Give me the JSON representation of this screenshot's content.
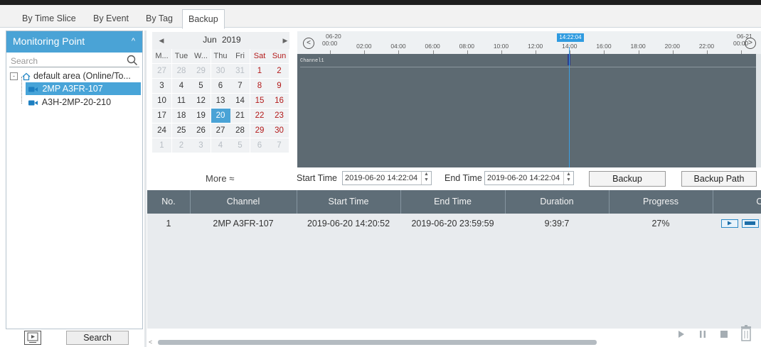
{
  "tabs": [
    {
      "label": "By Time Slice"
    },
    {
      "label": "By Event"
    },
    {
      "label": "By Tag"
    },
    {
      "label": "Backup"
    }
  ],
  "left_panel": {
    "title": "Monitoring Point",
    "search_placeholder": "Search",
    "tree_root": "default area (Online/To...",
    "cameras": [
      "2MP A3FR-107",
      "A3H-2MP-20-210"
    ],
    "search_button": "Search"
  },
  "calendar": {
    "month": "Jun",
    "year": "2019",
    "weekdays": [
      "M...",
      "Tue",
      "W...",
      "Thu",
      "Fri",
      "Sat",
      "Sun"
    ],
    "weeks": [
      [
        "27",
        "28",
        "29",
        "30",
        "31",
        "1",
        "2"
      ],
      [
        "3",
        "4",
        "5",
        "6",
        "7",
        "8",
        "9"
      ],
      [
        "10",
        "11",
        "12",
        "13",
        "14",
        "15",
        "16"
      ],
      [
        "17",
        "18",
        "19",
        "20",
        "21",
        "22",
        "23"
      ],
      [
        "24",
        "25",
        "26",
        "27",
        "28",
        "29",
        "30"
      ],
      [
        "1",
        "2",
        "3",
        "4",
        "5",
        "6",
        "7"
      ]
    ],
    "selected_day": "20",
    "more_label": "More ≈"
  },
  "timeline": {
    "start_date": "06-20",
    "end_date": "06-21",
    "ticks": [
      "00:00",
      "02:00",
      "04:00",
      "06:00",
      "08:00",
      "10:00",
      "12:00",
      "14:00",
      "16:00",
      "18:00",
      "20:00",
      "22:00",
      "00:00"
    ],
    "cursor_time": "14:22:04",
    "channel_label": "Channel1"
  },
  "time_controls": {
    "start_label": "Start Time",
    "start_value": "2019-06-20 14:22:04",
    "end_label": "End Time",
    "end_value": "2019-06-20 14:22:04",
    "backup_button": "Backup",
    "backup_path_button": "Backup Path"
  },
  "table": {
    "columns": [
      "No.",
      "Channel",
      "Start Time",
      "End Time",
      "Duration",
      "Progress",
      "Op"
    ],
    "rows": [
      {
        "no": "1",
        "channel": "2MP A3FR-107",
        "start": "2019-06-20 14:20:52",
        "end": "2019-06-20 23:59:59",
        "duration": "9:39:7",
        "progress": "27%"
      }
    ]
  }
}
